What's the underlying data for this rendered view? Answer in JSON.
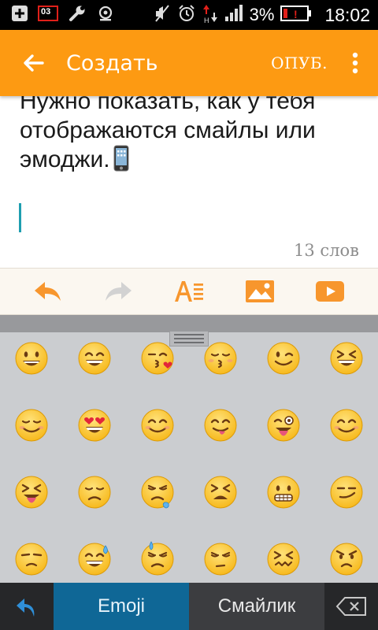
{
  "status_bar": {
    "sim_badge": "03",
    "battery_percent": "3%",
    "time": "18:02",
    "icons": [
      "add-box-icon",
      "sim-card-icon",
      "wrench-icon",
      "location-icon",
      "mute-icon",
      "alarm-icon",
      "data-transfer-icon",
      "signal-icon",
      "battery-low-icon"
    ]
  },
  "app_bar": {
    "title": "Создать",
    "publish_label": "ОПУБ.",
    "background": "#fd9a12"
  },
  "editor": {
    "body_text": "Нужно показать, как у тебя отображаются смайлы или эмоджи.",
    "inline_glyph": "mobile-phone-icon",
    "word_count": "13 слов",
    "cursor_color": "#1e9eb0"
  },
  "toolbar": {
    "icons": [
      "undo-icon",
      "redo-icon",
      "text-format-icon",
      "image-icon",
      "video-icon"
    ],
    "accent": "#f7962d",
    "disabled": "#d2d2d2"
  },
  "keyboard": {
    "emoji_rows": [
      [
        "grinning-face",
        "smiling-face-open-mouth",
        "face-blowing-kiss",
        "kissing-face-smiling-eyes",
        "winking-face",
        "grinning-squinting-face"
      ],
      [
        "relieved-face",
        "heart-eyes-face",
        "smiling-face",
        "face-savoring-food",
        "winking-face-tongue",
        "smiling-face-blush"
      ],
      [
        "squinting-face-tongue",
        "disappointed-face",
        "sleepy-face",
        "tired-face",
        "grimacing-face",
        "smirking-face"
      ],
      [
        "unamused-face",
        "grinning-face-sweat",
        "downcast-face-sweat",
        "pensive-face",
        "confounded-face",
        "angry-face"
      ]
    ],
    "tab_emoji": "Emoji",
    "tab_smiley": "Смайлик",
    "active_tab": "Emoji",
    "active_tab_color": "#0f6796"
  }
}
